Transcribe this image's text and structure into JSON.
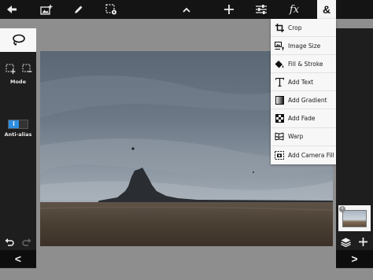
{
  "toolbar": {
    "items": [
      {
        "name": "back",
        "icon": "arrow-left-icon"
      },
      {
        "name": "add-image",
        "icon": "image-add-icon"
      },
      {
        "name": "brush",
        "icon": "pencil-icon"
      },
      {
        "name": "selection",
        "icon": "marquee-gear-icon"
      },
      {
        "name": "expand",
        "icon": "chevron-up-icon"
      },
      {
        "name": "add",
        "icon": "plus-icon"
      },
      {
        "name": "adjustments",
        "icon": "sliders-icon"
      },
      {
        "name": "effects",
        "icon": "fx-icon"
      },
      {
        "name": "more",
        "icon": "ampersand-icon",
        "active": true
      }
    ],
    "fx_label": "fx",
    "amp_label": "&"
  },
  "menu": {
    "items": [
      {
        "label": "Crop",
        "icon": "crop-icon"
      },
      {
        "label": "Image Size",
        "icon": "image-size-icon"
      },
      {
        "label": "Fill & Stroke",
        "icon": "paint-bucket-icon"
      },
      {
        "label": "Add Text",
        "icon": "text-icon"
      },
      {
        "label": "Add Gradient",
        "icon": "gradient-icon"
      },
      {
        "label": "Add Fade",
        "icon": "fade-icon"
      },
      {
        "label": "Warp",
        "icon": "warp-icon"
      },
      {
        "label": "Add Camera Fill",
        "icon": "camera-fill-icon"
      }
    ]
  },
  "left_panel": {
    "tool": "lasso-icon",
    "mode_label": "Mode",
    "antialias_label": "Anti-alias",
    "antialias_on": true,
    "antialias_mark": "I",
    "collapse_label": "<"
  },
  "right_panel": {
    "collapse_label": ">",
    "badge": "+"
  },
  "colors": {
    "bar": "#141414",
    "panel": "#1e1e1e",
    "canvas_bg": "#8e8e8e",
    "accent": "#2d8ee0"
  }
}
